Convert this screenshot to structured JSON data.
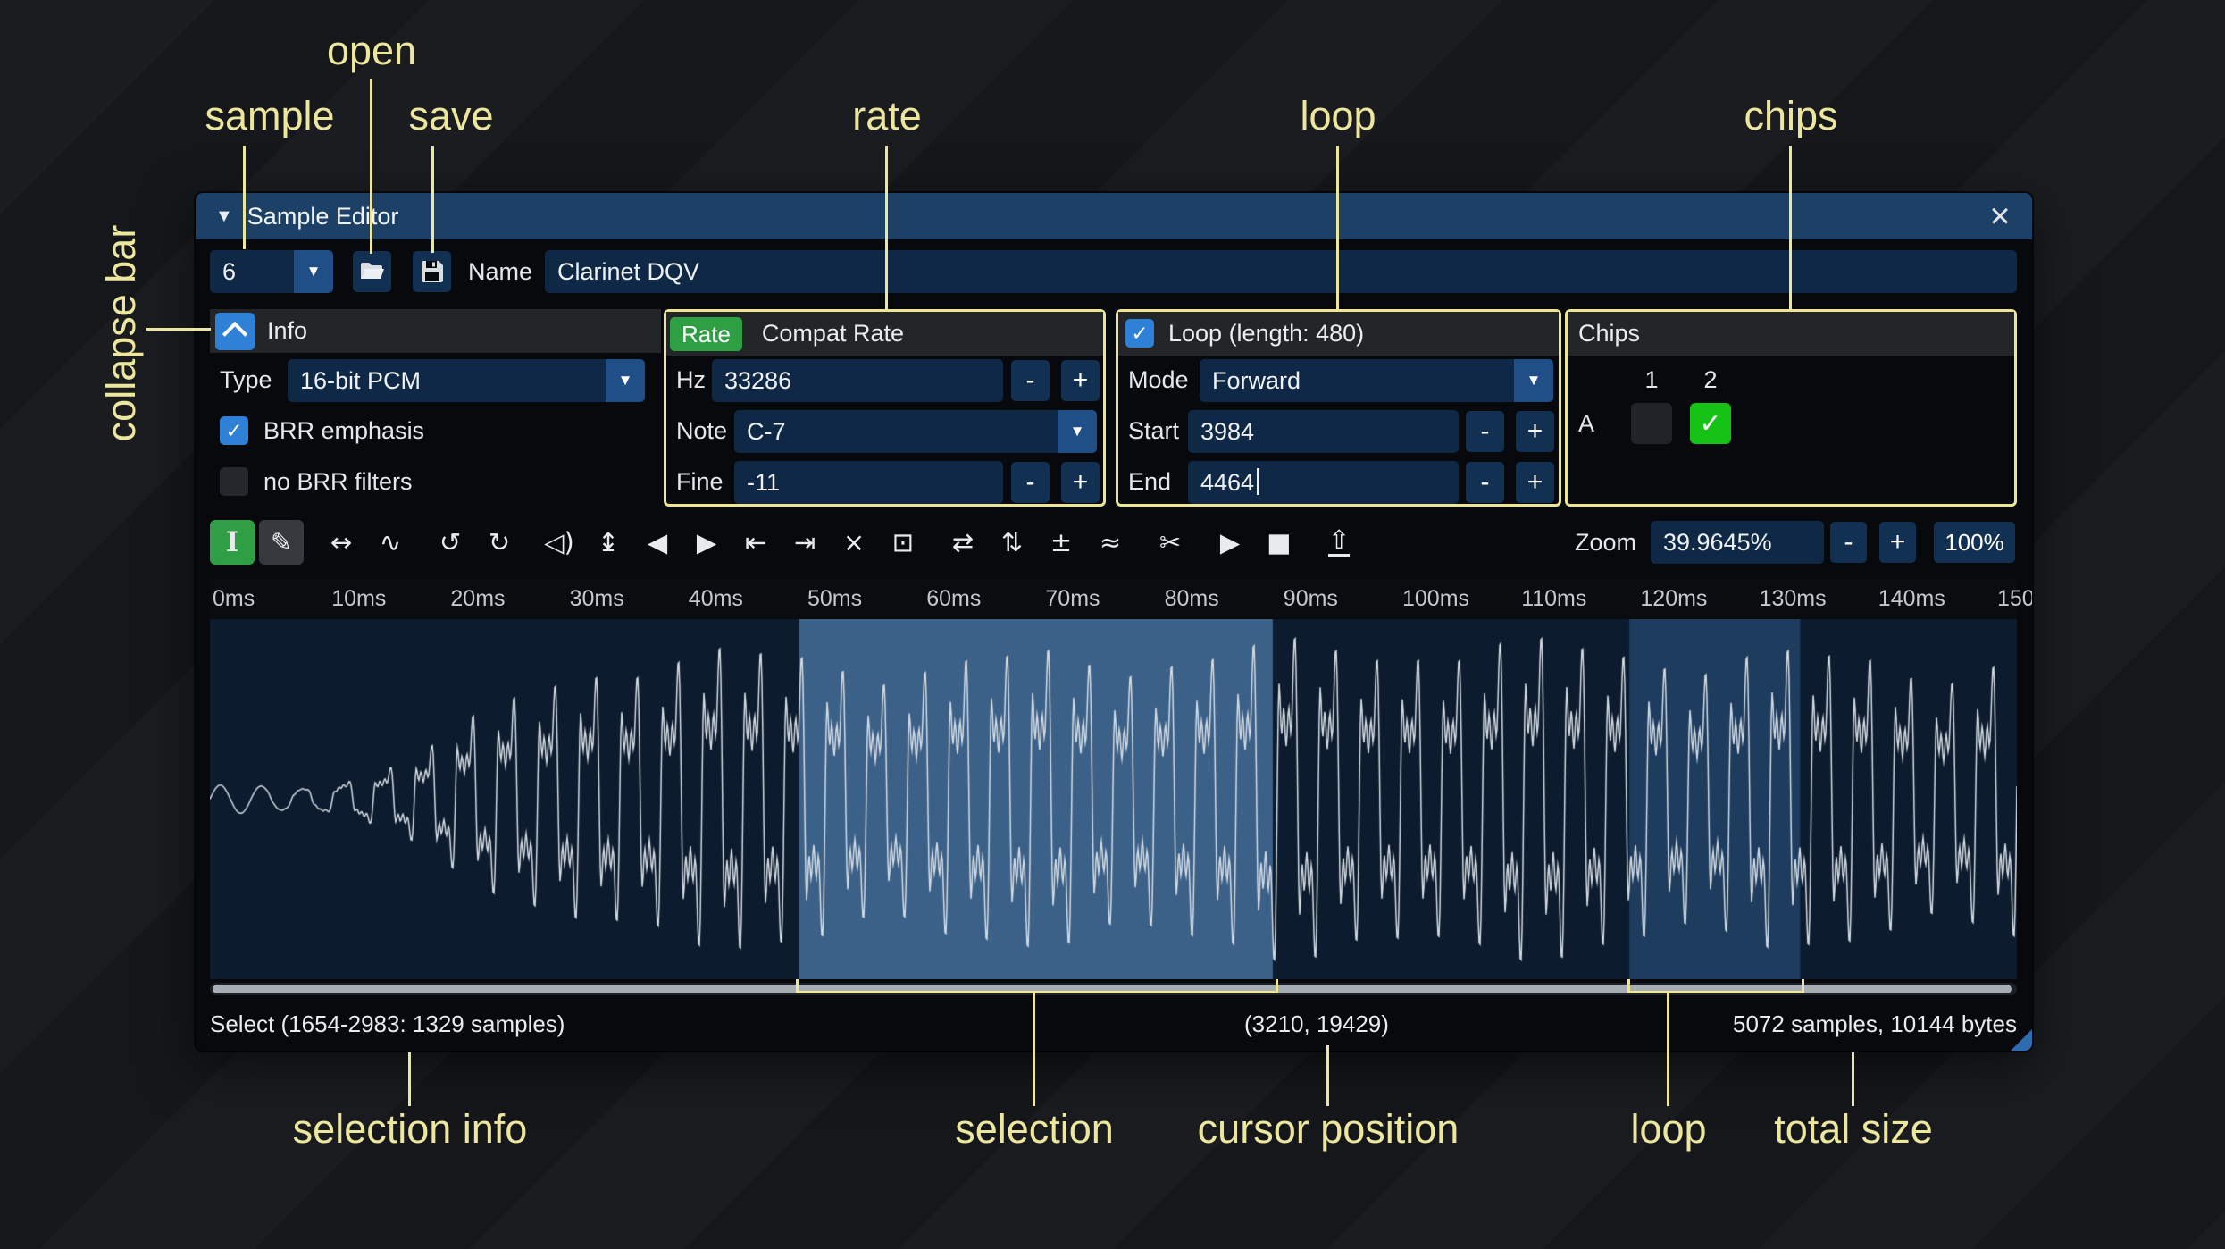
{
  "annotations": {
    "sample": "sample",
    "open": "open",
    "save": "save",
    "rate": "rate",
    "loop_top": "loop",
    "chips": "chips",
    "collapse_bar": "collapse bar",
    "selection_info": "selection info",
    "selection": "selection",
    "cursor_position": "cursor position",
    "loop_bottom": "loop",
    "total_size": "total size"
  },
  "icons": {
    "collapse": "▼",
    "dropdown": "▼",
    "close": "×",
    "check": "✓"
  },
  "titlebar": {
    "title": "Sample Editor"
  },
  "sample_row": {
    "index": "6",
    "name_label": "Name",
    "name_value": "Clarinet DQV"
  },
  "info": {
    "header": "Info",
    "type_label": "Type",
    "type_value": "16-bit PCM",
    "brr_emphasis": "BRR emphasis",
    "no_brr_filters": "no BRR filters"
  },
  "rate": {
    "badge": "Rate",
    "header": "Compat Rate",
    "hz_label": "Hz",
    "hz_value": "33286",
    "note_label": "Note",
    "note_value": "C-7",
    "fine_label": "Fine",
    "fine_value": "-11"
  },
  "loop": {
    "header": "Loop (length: 480)",
    "mode_label": "Mode",
    "mode_value": "Forward",
    "start_label": "Start",
    "start_value": "3984",
    "end_label": "End",
    "end_value": "4464"
  },
  "chips": {
    "header": "Chips",
    "col1": "1",
    "col2": "2",
    "row_a": "A"
  },
  "ui": {
    "minus": "-",
    "plus": "+"
  },
  "toolbar": {
    "zoom_label": "Zoom",
    "zoom_value": "39.9645%",
    "zoom_out": "-",
    "zoom_in": "+",
    "zoom_reset": "100%",
    "groups": [
      [
        {
          "name": "edit-mode-select",
          "glyph": "I",
          "style": "sel"
        },
        {
          "name": "edit-mode-draw",
          "glyph": "✎",
          "style": "drw"
        }
      ],
      [
        {
          "name": "resize",
          "glyph": "↔"
        },
        {
          "name": "resample",
          "glyph": "∿"
        }
      ],
      [
        {
          "name": "undo",
          "glyph": "↺"
        },
        {
          "name": "redo",
          "glyph": "↻"
        }
      ],
      [
        {
          "name": "amplify",
          "glyph": "◁)"
        },
        {
          "name": "normalize",
          "glyph": "↨"
        },
        {
          "name": "fade-in",
          "glyph": "◀"
        },
        {
          "name": "fade-out",
          "glyph": "▶"
        },
        {
          "name": "insert-silence",
          "glyph": "⇤"
        },
        {
          "name": "apply-silence",
          "glyph": "⇥"
        },
        {
          "name": "delete",
          "glyph": "×"
        },
        {
          "name": "trim",
          "glyph": "⊡"
        }
      ],
      [
        {
          "name": "reverse",
          "glyph": "⇄"
        },
        {
          "name": "invert",
          "glyph": "⇅"
        },
        {
          "name": "sign-invert",
          "glyph": "±"
        },
        {
          "name": "apply-filter",
          "glyph": "≈"
        }
      ],
      [
        {
          "name": "crossfade-loop",
          "glyph": "✂"
        }
      ],
      [
        {
          "name": "preview",
          "glyph": "▶"
        },
        {
          "name": "stop-preview",
          "glyph": "■"
        }
      ],
      [
        {
          "name": "create-wavetable",
          "glyph": "⇧",
          "style": "tray"
        }
      ]
    ]
  },
  "ruler": {
    "ticks": [
      "0ms",
      "10ms",
      "20ms",
      "30ms",
      "40ms",
      "50ms",
      "60ms",
      "70ms",
      "80ms",
      "90ms",
      "100ms",
      "110ms",
      "120ms",
      "130ms",
      "140ms",
      "150"
    ]
  },
  "waveform": {
    "selection": [
      0.3261,
      0.5882
    ],
    "loop_region": [
      0.7855,
      0.8801
    ],
    "bg": "#0c1b2e",
    "selection_color": "#3c6188",
    "loop_color": "#1d3c5e",
    "line_color": "#d6dde4"
  },
  "status": {
    "selection": "Select (1654-2983: 1329 samples)",
    "cursor": "(3210, 19429)",
    "size": "5072 samples, 10144 bytes"
  }
}
